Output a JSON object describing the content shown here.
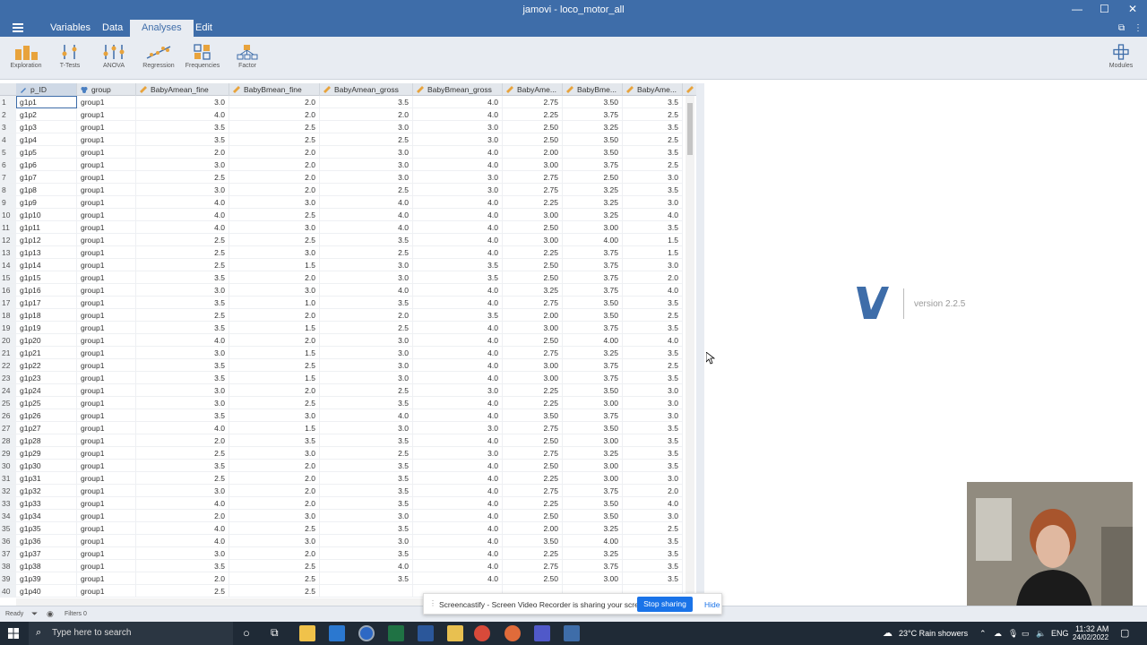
{
  "window": {
    "title": "jamovi - loco_motor_all"
  },
  "tabs": [
    {
      "label": "Variables",
      "active": false
    },
    {
      "label": "Data",
      "active": false
    },
    {
      "label": "Analyses",
      "active": true
    },
    {
      "label": "Edit",
      "active": false
    }
  ],
  "ribbon": {
    "items": [
      {
        "label": "Exploration",
        "icon": "exploration-icon"
      },
      {
        "label": "T-Tests",
        "icon": "t-tests-icon"
      },
      {
        "label": "ANOVA",
        "icon": "anova-icon"
      },
      {
        "label": "Regression",
        "icon": "regression-icon"
      },
      {
        "label": "Frequencies",
        "icon": "frequencies-icon"
      },
      {
        "label": "Factor",
        "icon": "factor-icon"
      }
    ],
    "modules_label": "Modules"
  },
  "grid": {
    "columns": [
      "p_ID",
      "group",
      "BabyAmean_fine",
      "BabyBmean_fine",
      "BabyAmean_gross",
      "BabyBmean_gross",
      "BabyAme...",
      "BabyBme...",
      "BabyAme..."
    ],
    "rows": [
      [
        "1",
        "g1p1",
        "group1",
        "3.0",
        "2.0",
        "3.5",
        "4.0",
        "2.75",
        "3.50",
        "3.5"
      ],
      [
        "2",
        "g1p2",
        "group1",
        "4.0",
        "2.0",
        "2.0",
        "4.0",
        "2.25",
        "3.75",
        "2.5"
      ],
      [
        "3",
        "g1p3",
        "group1",
        "3.5",
        "2.5",
        "3.0",
        "3.0",
        "2.50",
        "3.25",
        "3.5"
      ],
      [
        "4",
        "g1p4",
        "group1",
        "3.5",
        "2.5",
        "2.5",
        "3.0",
        "2.50",
        "3.50",
        "2.5"
      ],
      [
        "5",
        "g1p5",
        "group1",
        "2.0",
        "2.0",
        "3.0",
        "4.0",
        "2.00",
        "3.50",
        "3.5"
      ],
      [
        "6",
        "g1p6",
        "group1",
        "3.0",
        "2.0",
        "3.0",
        "4.0",
        "3.00",
        "3.75",
        "2.5"
      ],
      [
        "7",
        "g1p7",
        "group1",
        "2.5",
        "2.0",
        "3.0",
        "3.0",
        "2.75",
        "2.50",
        "3.0"
      ],
      [
        "8",
        "g1p8",
        "group1",
        "3.0",
        "2.0",
        "2.5",
        "3.0",
        "2.75",
        "3.25",
        "3.5"
      ],
      [
        "9",
        "g1p9",
        "group1",
        "4.0",
        "3.0",
        "4.0",
        "4.0",
        "2.25",
        "3.25",
        "3.0"
      ],
      [
        "10",
        "g1p10",
        "group1",
        "4.0",
        "2.5",
        "4.0",
        "4.0",
        "3.00",
        "3.25",
        "4.0"
      ],
      [
        "11",
        "g1p11",
        "group1",
        "4.0",
        "3.0",
        "4.0",
        "4.0",
        "2.50",
        "3.00",
        "3.5"
      ],
      [
        "12",
        "g1p12",
        "group1",
        "2.5",
        "2.5",
        "3.5",
        "4.0",
        "3.00",
        "4.00",
        "1.5"
      ],
      [
        "13",
        "g1p13",
        "group1",
        "2.5",
        "3.0",
        "2.5",
        "4.0",
        "2.25",
        "3.75",
        "1.5"
      ],
      [
        "14",
        "g1p14",
        "group1",
        "2.5",
        "1.5",
        "3.0",
        "3.5",
        "2.50",
        "3.75",
        "3.0"
      ],
      [
        "15",
        "g1p15",
        "group1",
        "3.5",
        "2.0",
        "3.0",
        "3.5",
        "2.50",
        "3.75",
        "2.0"
      ],
      [
        "16",
        "g1p16",
        "group1",
        "3.0",
        "3.0",
        "4.0",
        "4.0",
        "3.25",
        "3.75",
        "4.0"
      ],
      [
        "17",
        "g1p17",
        "group1",
        "3.5",
        "1.0",
        "3.5",
        "4.0",
        "2.75",
        "3.50",
        "3.5"
      ],
      [
        "18",
        "g1p18",
        "group1",
        "2.5",
        "2.0",
        "2.0",
        "3.5",
        "2.00",
        "3.50",
        "2.5"
      ],
      [
        "19",
        "g1p19",
        "group1",
        "3.5",
        "1.5",
        "2.5",
        "4.0",
        "3.00",
        "3.75",
        "3.5"
      ],
      [
        "20",
        "g1p20",
        "group1",
        "4.0",
        "2.0",
        "3.0",
        "4.0",
        "2.50",
        "4.00",
        "4.0"
      ],
      [
        "21",
        "g1p21",
        "group1",
        "3.0",
        "1.5",
        "3.0",
        "4.0",
        "2.75",
        "3.25",
        "3.5"
      ],
      [
        "22",
        "g1p22",
        "group1",
        "3.5",
        "2.5",
        "3.0",
        "4.0",
        "3.00",
        "3.75",
        "2.5"
      ],
      [
        "23",
        "g1p23",
        "group1",
        "3.5",
        "1.5",
        "3.0",
        "4.0",
        "3.00",
        "3.75",
        "3.5"
      ],
      [
        "24",
        "g1p24",
        "group1",
        "3.0",
        "2.0",
        "2.5",
        "3.0",
        "2.25",
        "3.50",
        "3.0"
      ],
      [
        "25",
        "g1p25",
        "group1",
        "3.0",
        "2.5",
        "3.5",
        "4.0",
        "2.25",
        "3.00",
        "3.0"
      ],
      [
        "26",
        "g1p26",
        "group1",
        "3.5",
        "3.0",
        "4.0",
        "4.0",
        "3.50",
        "3.75",
        "3.0"
      ],
      [
        "27",
        "g1p27",
        "group1",
        "4.0",
        "1.5",
        "3.0",
        "3.0",
        "2.75",
        "3.50",
        "3.5"
      ],
      [
        "28",
        "g1p28",
        "group1",
        "2.0",
        "3.5",
        "3.5",
        "4.0",
        "2.50",
        "3.00",
        "3.5"
      ],
      [
        "29",
        "g1p29",
        "group1",
        "2.5",
        "3.0",
        "2.5",
        "3.0",
        "2.75",
        "3.25",
        "3.5"
      ],
      [
        "30",
        "g1p30",
        "group1",
        "3.5",
        "2.0",
        "3.5",
        "4.0",
        "2.50",
        "3.00",
        "3.5"
      ],
      [
        "31",
        "g1p31",
        "group1",
        "2.5",
        "2.0",
        "3.5",
        "4.0",
        "2.25",
        "3.00",
        "3.0"
      ],
      [
        "32",
        "g1p32",
        "group1",
        "3.0",
        "2.0",
        "3.5",
        "4.0",
        "2.75",
        "3.75",
        "2.0"
      ],
      [
        "33",
        "g1p33",
        "group1",
        "4.0",
        "2.0",
        "3.5",
        "4.0",
        "2.25",
        "3.50",
        "4.0"
      ],
      [
        "34",
        "g1p34",
        "group1",
        "2.0",
        "3.0",
        "3.0",
        "4.0",
        "2.50",
        "3.50",
        "3.0"
      ],
      [
        "35",
        "g1p35",
        "group1",
        "4.0",
        "2.5",
        "3.5",
        "4.0",
        "2.00",
        "3.25",
        "2.5"
      ],
      [
        "36",
        "g1p36",
        "group1",
        "4.0",
        "3.0",
        "3.0",
        "4.0",
        "3.50",
        "4.00",
        "3.5"
      ],
      [
        "37",
        "g1p37",
        "group1",
        "3.0",
        "2.0",
        "3.5",
        "4.0",
        "2.25",
        "3.25",
        "3.5"
      ],
      [
        "38",
        "g1p38",
        "group1",
        "3.5",
        "2.5",
        "4.0",
        "4.0",
        "2.75",
        "3.75",
        "3.5"
      ],
      [
        "39",
        "g1p39",
        "group1",
        "2.0",
        "2.5",
        "3.5",
        "4.0",
        "2.50",
        "3.00",
        "3.5"
      ],
      [
        "40",
        "g1p40",
        "group1",
        "2.5",
        "2.5",
        "",
        "",
        "",
        "",
        ""
      ]
    ]
  },
  "results": {
    "version": "version 2.2.5"
  },
  "status": {
    "ready": "Ready",
    "filters": "Filters 0"
  },
  "screencastify": {
    "message": "Screencastify - Screen Video Recorder is sharing your screen.",
    "stop_label": "Stop sharing",
    "hide_label": "Hide"
  },
  "taskbar": {
    "search_placeholder": "Type here to search",
    "weather": "23°C  Rain showers",
    "language": "ENG",
    "time": "11:32 AM",
    "date": "24/02/2022"
  },
  "colors": {
    "accent": "#3e6da9",
    "ribbon_bg": "#e8ecf2",
    "icon_orange": "#e8a33c"
  }
}
